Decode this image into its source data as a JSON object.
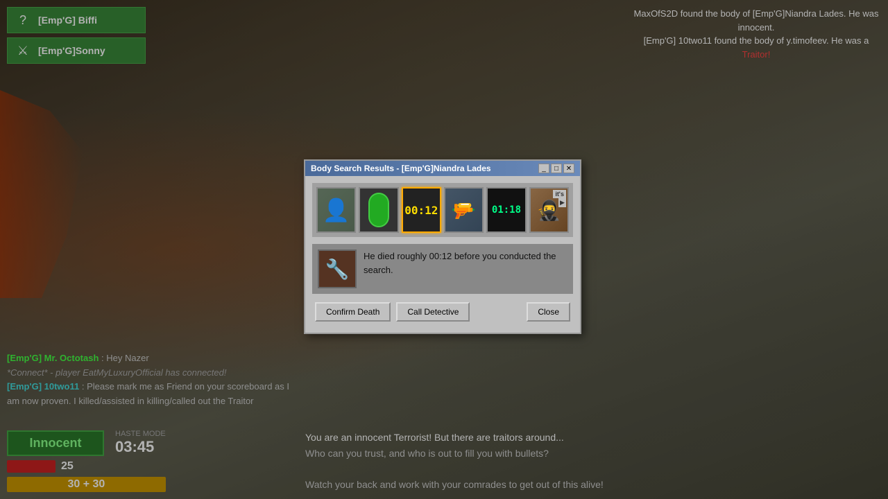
{
  "game": {
    "background_desc": "industrial game map"
  },
  "notifications": {
    "line1": "MaxOfS2D found the body of [Emp'G]Niandra Lades. He was innocent.",
    "line2_part1": "[Emp'G] 10two11 found the body of y.timofeev. He was a ",
    "line2_traitor": "Traitor!"
  },
  "players": [
    {
      "name": "[Emp'G] Biffi",
      "icon": "?"
    },
    {
      "name": "[Emp'G]Sonny",
      "icon": "⚔"
    }
  ],
  "chat": [
    {
      "type": "player",
      "name": "[Emp'G] Mr. Octotash",
      "name_color": "green",
      "msg": " Hey Nazer"
    },
    {
      "type": "connect",
      "msg": "*Connect* - player EatMyLuxuryOfficial has connected!"
    },
    {
      "type": "player",
      "name": "[Emp'G] 10two11",
      "name_color": "teal",
      "msg": ": Please mark me as Friend on your scoreboard as I am now proven. I killed/assisted in killing/called out the Traitor"
    }
  ],
  "hud": {
    "role": "Innocent",
    "haste_label": "HASTE MODE",
    "timer": "03:45",
    "health": 25,
    "ammo": "30 + 30"
  },
  "bottom_message": {
    "line1": "You are an innocent Terrorist! But there are traitors around...",
    "line2": "Who can you trust, and who is out to fill you with bullets?",
    "line3": "",
    "line4": "Watch your back and work with your comrades to get out of this alive!"
  },
  "dialog": {
    "title": "Body Search Results - [Emp'G]Niandra Lades",
    "evidence_items": [
      {
        "type": "face",
        "label": "face"
      },
      {
        "type": "green_pill",
        "label": "green pill"
      },
      {
        "type": "timer",
        "value": "00:12",
        "label": "time of death",
        "selected": true
      },
      {
        "type": "rifle",
        "label": "rifle"
      },
      {
        "type": "timer2",
        "value": "01:18",
        "label": "timer 2"
      },
      {
        "type": "masked",
        "label": "masked figure",
        "badge": "it's"
      }
    ],
    "info_icon": "🔧",
    "info_text": "He died roughly 00:12 before you conducted the search.",
    "buttons": {
      "confirm_death": "Confirm Death",
      "call_detective": "Call Detective",
      "close": "Close"
    },
    "window_controls": {
      "minimize": "_",
      "maximize": "□",
      "close": "✕"
    }
  }
}
